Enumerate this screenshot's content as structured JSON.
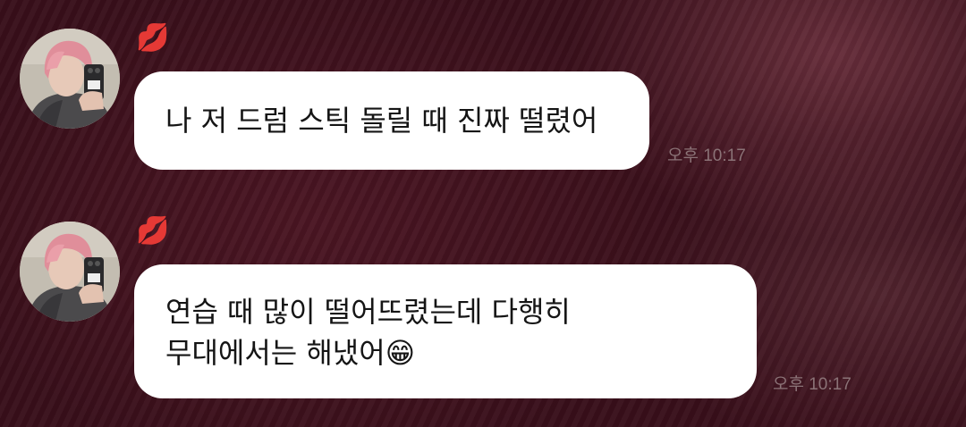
{
  "messages": [
    {
      "sender_icon": "lips-emoji",
      "sender_glyph": "💋",
      "lines": [
        "나 저 드럼 스틱 돌릴 때 진짜 떨렸어"
      ],
      "time": "오후 10:17"
    },
    {
      "sender_icon": "lips-emoji",
      "sender_glyph": "💋",
      "lines": [
        "연습 때 많이 떨어뜨렸는데 다행히",
        "무대에서는 해냈어😁"
      ],
      "time": "오후 10:17"
    }
  ],
  "colors": {
    "background": "#3a1019",
    "bubble": "#ffffff",
    "text": "#151515",
    "time": "#8b7377",
    "sender_accent": "#d8163a"
  }
}
